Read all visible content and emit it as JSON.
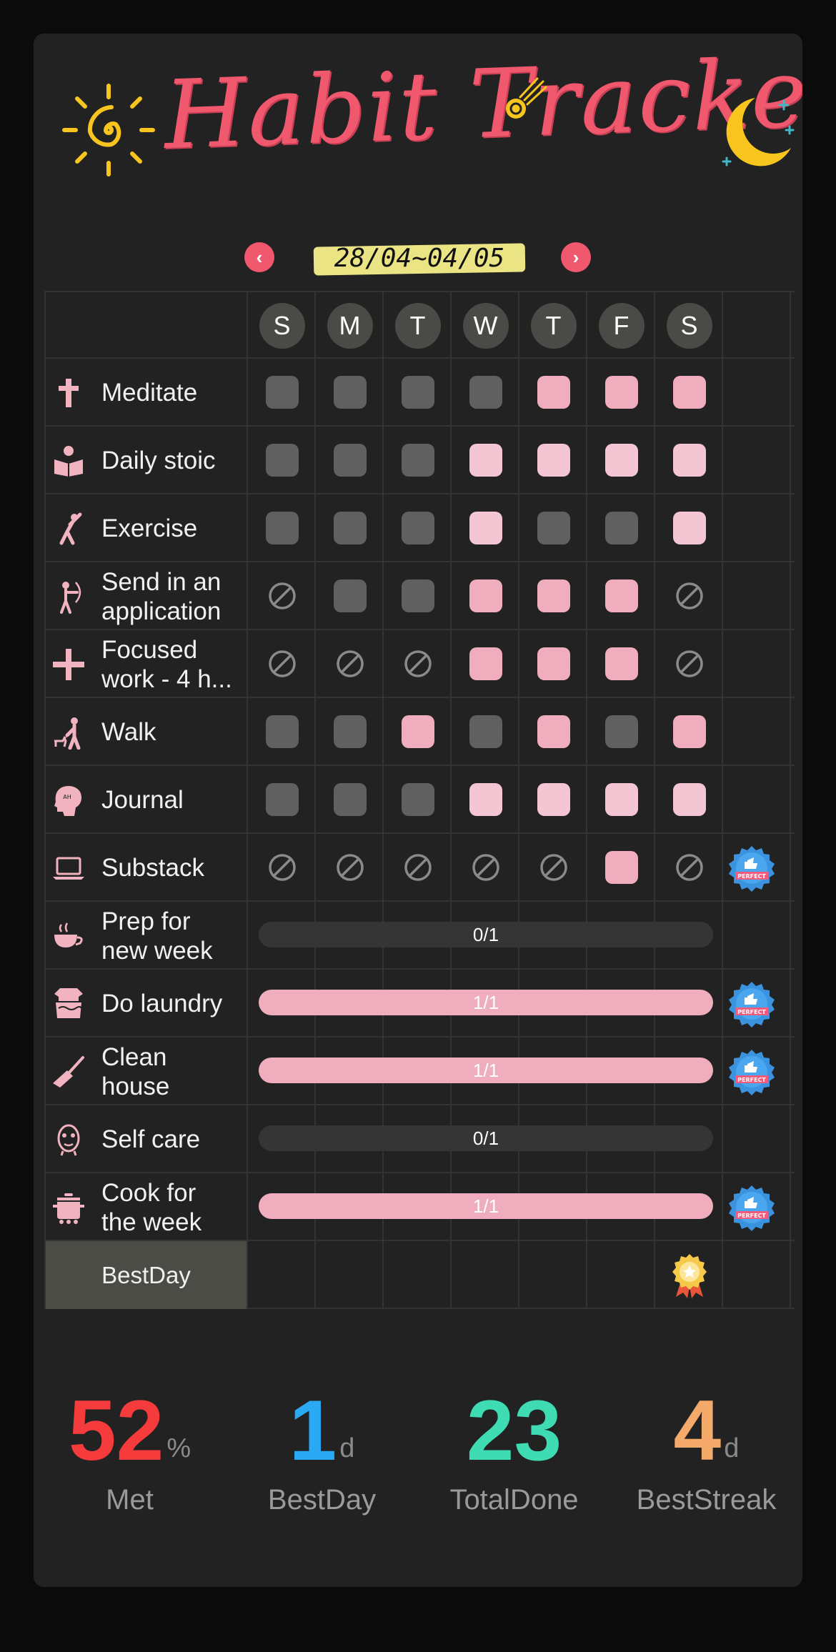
{
  "header": {
    "title": "Habit Tracker",
    "range": "28/04~04/05",
    "prev_label": "‹",
    "next_label": "›"
  },
  "days": [
    "S",
    "M",
    "T",
    "W",
    "T",
    "F",
    "S"
  ],
  "habits": [
    {
      "label": "Meditate",
      "icon": "cross-icon",
      "type": "days",
      "marks": [
        "empty",
        "empty",
        "empty",
        "empty",
        "done",
        "done",
        "done"
      ],
      "perfect": false
    },
    {
      "label": "Daily stoic",
      "icon": "reading-icon",
      "type": "days",
      "marks": [
        "empty",
        "empty",
        "empty",
        "done-light",
        "done-light",
        "done-light",
        "done-light"
      ],
      "perfect": false
    },
    {
      "label": "Exercise",
      "icon": "stretch-icon",
      "type": "days",
      "marks": [
        "empty",
        "empty",
        "empty",
        "done-light",
        "empty",
        "empty",
        "done-light"
      ],
      "perfect": false
    },
    {
      "label": "Send in an\napplication",
      "icon": "archer-icon",
      "type": "days",
      "marks": [
        "na",
        "empty",
        "empty",
        "done",
        "done",
        "done",
        "na"
      ],
      "perfect": false
    },
    {
      "label": "Focused\nwork - 4 h...",
      "icon": "plus-icon",
      "type": "days",
      "marks": [
        "na",
        "na",
        "na",
        "done",
        "done",
        "done",
        "na"
      ],
      "perfect": false
    },
    {
      "label": "Walk",
      "icon": "dog-walk-icon",
      "type": "days",
      "marks": [
        "empty",
        "empty",
        "done",
        "empty",
        "done",
        "empty",
        "done"
      ],
      "perfect": false
    },
    {
      "label": "Journal",
      "icon": "head-icon",
      "type": "days",
      "marks": [
        "empty",
        "empty",
        "empty",
        "done-light",
        "done-light",
        "done-light",
        "done-light"
      ],
      "perfect": false
    },
    {
      "label": "Substack",
      "icon": "laptop-icon",
      "type": "days",
      "marks": [
        "na",
        "na",
        "na",
        "na",
        "na",
        "done",
        "na"
      ],
      "perfect": true
    },
    {
      "label": "Prep for\nnew week",
      "icon": "teacup-icon",
      "type": "count",
      "progress": "0/1",
      "fill": 0,
      "perfect": false
    },
    {
      "label": "Do laundry",
      "icon": "laundry-icon",
      "type": "count",
      "progress": "1/1",
      "fill": 1,
      "perfect": true
    },
    {
      "label": "Clean\nhouse",
      "icon": "broom-icon",
      "type": "count",
      "progress": "1/1",
      "fill": 1,
      "perfect": true
    },
    {
      "label": "Self care",
      "icon": "face-mask-icon",
      "type": "count",
      "progress": "0/1",
      "fill": 0,
      "perfect": false
    },
    {
      "label": "Cook for\nthe week",
      "icon": "pot-icon",
      "type": "count",
      "progress": "1/1",
      "fill": 1,
      "perfect": true
    }
  ],
  "bestday": {
    "label": "BestDay",
    "medal_day_index": 6
  },
  "perfect_badge_text": "PERFECT",
  "stats": [
    {
      "value": "52",
      "unit": "%",
      "label": "Met",
      "color": "#f53b3b"
    },
    {
      "value": "1",
      "unit": "d",
      "label": "BestDay",
      "color": "#2aa9f5"
    },
    {
      "value": "23",
      "unit": "",
      "label": "TotalDone",
      "color": "#3fdcb4"
    },
    {
      "value": "4",
      "unit": "d",
      "label": "BestStreak",
      "color": "#f5a96a"
    }
  ],
  "colors": {
    "accent": "#f0586e",
    "done": "#f0adbd",
    "empty": "#606060",
    "background": "#222222"
  }
}
